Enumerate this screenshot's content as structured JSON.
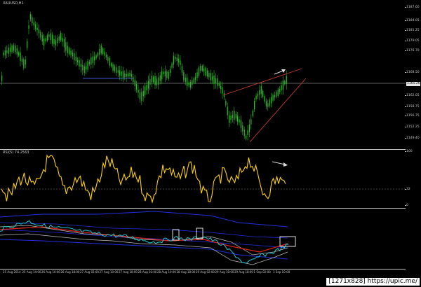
{
  "chart": {
    "symbol_label": "XAUUSD,H1",
    "rsi_label": "RSI(5) 74.2563",
    "current_price": "1165.26",
    "price_ticks": [
      "1187.60",
      "1184.05",
      "1181.25",
      "1179.05",
      "1176.70",
      "1168.50",
      "1162.05",
      "1158.75",
      "1156.75",
      "1152.25",
      "1149.40"
    ],
    "rsi_ticks": [
      "100",
      "32",
      "0"
    ],
    "time_ticks": [
      "25 Aug 2014",
      "25 Aug 14:00",
      "26 Aug 10:00",
      "26 Aug 18:00",
      "27 Aug 02:00",
      "27 Aug 10:00",
      "27 Aug 18:00",
      "28 Aug 02:00",
      "28 Aug 10:00",
      "28 Aug 18:00",
      "29 Aug 02:00",
      "29 Aug 10:00",
      "29 Aug 18:00",
      "1 Sep 02:00",
      "1 Sep 10:00"
    ]
  },
  "colors": {
    "candle": "#22c21a",
    "rsi_line": "#ffd400",
    "trend_line": "#c0392b",
    "arrow": "#dcdcdc",
    "band": "#2030e0",
    "cyan": "#1ec8d0",
    "red": "#e0221a"
  },
  "watermark": "[1271x828] https://upic.me/"
}
